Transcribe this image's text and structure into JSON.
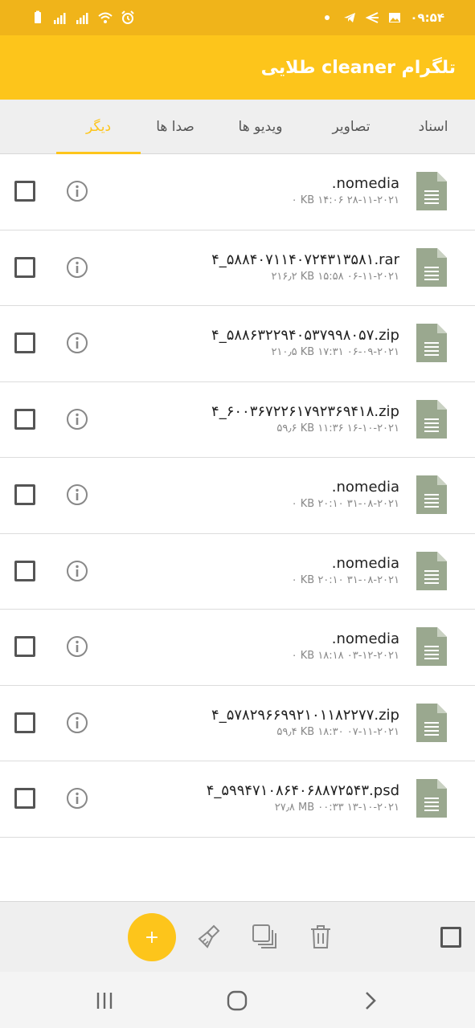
{
  "status_bar": {
    "time": "۰۹:۵۴",
    "icons": [
      "battery-icon",
      "signal-icon",
      "signal-icon",
      "wifi-icon",
      "alarm-icon",
      "dot-icon",
      "telegram-icon",
      "back-arrow-icon",
      "image-icon"
    ]
  },
  "app_bar": {
    "title": "تلگرام cleaner طلایی"
  },
  "tabs": [
    {
      "label": "اسناد",
      "active": false
    },
    {
      "label": "تصاویر",
      "active": false
    },
    {
      "label": "ویدیو ها",
      "active": false
    },
    {
      "label": "صدا ها",
      "active": false
    },
    {
      "label": "دیگر",
      "active": true
    }
  ],
  "files": [
    {
      "name": ".nomedia",
      "meta": "۰ KB  ۱۴:۰۶ ۲۸-۱۱-۲۰۲۱"
    },
    {
      "name": "۴_۵۸۸۴۰۷۱۱۴۰۷۲۴۳۱۳۵۸۱.rar",
      "meta": "۲۱۶٫۲ KB  ۱۵:۵۸ ۰۶-۱۱-۲۰۲۱"
    },
    {
      "name": "۴_۵۸۸۶۳۲۲۹۴۰۵۳۷۹۹۸۰۵۷.zip",
      "meta": "۲۱۰٫۵ KB  ۱۷:۳۱ ۰۶-۰۹-۲۰۲۱"
    },
    {
      "name": "۴_۶۰۰۳۶۷۲۲۶۱۷۹۲۳۶۹۴۱۸.zip",
      "meta": "۵۹٫۶ KB  ۱۱:۳۶ ۱۶-۱۰-۲۰۲۱"
    },
    {
      "name": ".nomedia",
      "meta": "۰ KB  ۲۰:۱۰ ۳۱-۰۸-۲۰۲۱"
    },
    {
      "name": ".nomedia",
      "meta": "۰ KB  ۲۰:۱۰ ۳۱-۰۸-۲۰۲۱"
    },
    {
      "name": ".nomedia",
      "meta": "۰ KB  ۱۸:۱۸ ۰۳-۱۲-۲۰۲۱"
    },
    {
      "name": "۴_۵۷۸۲۹۶۶۹۹۲۱۰۱۱۸۲۲۷۷.zip",
      "meta": "۵۹٫۴ KB  ۱۸:۳۰ ۰۷-۱۱-۲۰۲۱"
    },
    {
      "name": "۴_۵۹۹۴۷۱۰۸۶۴۰۶۸۸۷۲۵۴۳.psd",
      "meta": "۲۷٫۸ MB  ۰۰:۳۳ ۱۳-۱۰-۲۰۲۱"
    }
  ],
  "bottom_bar": {
    "fab_label": "+"
  },
  "colors": {
    "accent": "#fdc51b",
    "status_bar": "#f0b41a",
    "file_icon": "#9aa88f",
    "tab_bg": "#efefef"
  }
}
